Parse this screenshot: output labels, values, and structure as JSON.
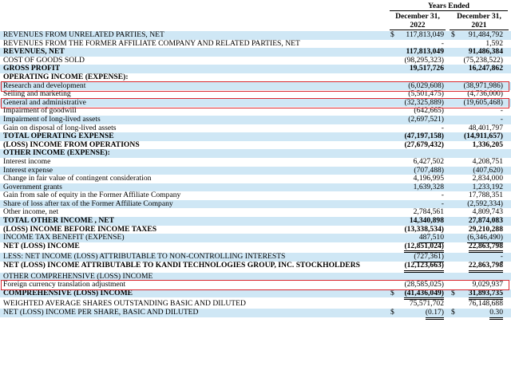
{
  "header": {
    "years_ended": "Years Ended",
    "col1": {
      "line1": "December 31,",
      "line2": "2022"
    },
    "col2": {
      "line1": "December 31,",
      "line2": "2021"
    }
  },
  "rows": [
    {
      "label": "REVENUES FROM UNRELATED PARTIES, NET",
      "v1": "117,813,049",
      "v2": "91,484,792",
      "d1": "$",
      "d2": "$",
      "alt": true
    },
    {
      "label": "REVENUES FROM THE FORMER AFFILIATE COMPANY AND RELATED PARTIES, NET",
      "v1": "-",
      "v2": "1,592"
    },
    {
      "label": "REVENUES, NET",
      "v1": "117,813,049",
      "v2": "91,486,384",
      "bold": true,
      "alt": true
    },
    {
      "label": "COST OF GOODS SOLD",
      "v1": "(98,295,323)",
      "v2": "(75,238,522)"
    },
    {
      "label": "GROSS PROFIT",
      "v1": "19,517,726",
      "v2": "16,247,862",
      "bold": true,
      "alt": true
    },
    {
      "label": "OPERATING INCOME (EXPENSE):",
      "v1": "",
      "v2": "",
      "bold": true
    },
    {
      "label": "Research and development",
      "v1": "(6,029,608)",
      "v2": "(38,971,986)",
      "alt": true
    },
    {
      "label": "Selling and marketing",
      "v1": "(5,501,475)",
      "v2": "(4,736,000)"
    },
    {
      "label": "General and administrative",
      "v1": "(32,325,889)",
      "v2": "(19,605,468)",
      "alt": true
    },
    {
      "label": "Impairment of goodwill",
      "v1": "(642,665)",
      "v2": "-"
    },
    {
      "label": "Impairment of long-lived assets",
      "v1": "(2,697,521)",
      "v2": "-",
      "alt": true
    },
    {
      "label": "Gain on disposal of long-lived assets",
      "v1": "-",
      "v2": "48,401,797"
    },
    {
      "label": "TOTAL OPERATING EXPENSE",
      "v1": "(47,197,158)",
      "v2": "(14,911,657)",
      "bold": true,
      "alt": true
    },
    {
      "label": "(LOSS) INCOME FROM OPERATIONS",
      "v1": "(27,679,432)",
      "v2": "1,336,205",
      "bold": true
    },
    {
      "label": "OTHER INCOME (EXPENSE):",
      "v1": "",
      "v2": "",
      "bold": true,
      "alt": true
    },
    {
      "label": "Interest income",
      "v1": "6,427,502",
      "v2": "4,208,751"
    },
    {
      "label": "Interest expense",
      "v1": "(707,488)",
      "v2": "(407,620)",
      "alt": true
    },
    {
      "label": "Change in fair value of contingent consideration",
      "v1": "4,196,995",
      "v2": "2,834,000"
    },
    {
      "label": "Government grants",
      "v1": "1,639,328",
      "v2": "1,233,192",
      "alt": true
    },
    {
      "label": "Gain from sale of equity in the Former Affiliate Company",
      "v1": "-",
      "v2": "17,788,351"
    },
    {
      "label": "Share of loss after tax of the Former Affiliate Company",
      "v1": "-",
      "v2": "(2,592,334)",
      "alt": true
    },
    {
      "label": "Other income, net",
      "v1": "2,784,561",
      "v2": "4,809,743"
    },
    {
      "label": "TOTAL OTHER INCOME , NET",
      "v1": "14,340,898",
      "v2": "27,874,083",
      "bold": true,
      "alt": true
    },
    {
      "label": "(LOSS) INCOME BEFORE INCOME TAXES",
      "v1": "(13,338,534)",
      "v2": "29,210,288",
      "bold": true
    },
    {
      "label": "INCOME TAX BENEFIT (EXPENSE)",
      "v1": "487,510",
      "v2": "(6,346,490)",
      "alt": true
    },
    {
      "label": "NET (LOSS) INCOME",
      "v1": "(12,851,024)",
      "v2": "22,863,798",
      "bold": true
    },
    {
      "label": "LESS: NET INCOME (LOSS) ATTRIBUTABLE TO NON-CONTROLLING INTERESTS",
      "v1": "(727,361)",
      "v2": "-",
      "alt": true,
      "gap": true
    },
    {
      "label": "NET (LOSS) INCOME ATTRIBUTABLE TO KANDI TECHNOLOGIES GROUP, INC. STOCKHOLDERS",
      "v1": "(12,123,663)",
      "v2": "22,863,798",
      "bold": true
    },
    {
      "label": "OTHER COMPREHENSIVE (LOSS) INCOME",
      "v1": "",
      "v2": "",
      "alt": true,
      "gap": true
    },
    {
      "label": "Foreign currency translation adjustment",
      "v1": "(28,585,025)",
      "v2": "9,029,937"
    },
    {
      "label": "COMPREHENSIVE (LOSS) INCOME",
      "v1": "(41,436,049)",
      "v2": "31,893,735",
      "d1": "$",
      "d2": "$",
      "bold": true,
      "alt": true
    },
    {
      "label": "WEIGHTED AVERAGE SHARES OUTSTANDING BASIC AND DILUTED",
      "v1": "75,571,702",
      "v2": "76,148,688",
      "gap": true
    },
    {
      "label": "NET (LOSS) INCOME PER SHARE, BASIC AND DILUTED",
      "v1": "(0.17)",
      "v2": "0.30",
      "d1": "$",
      "d2": "$",
      "alt": true
    }
  ],
  "colors": {
    "row_highlight": "#cfe7f5",
    "annotation_box": "#d9282f"
  }
}
